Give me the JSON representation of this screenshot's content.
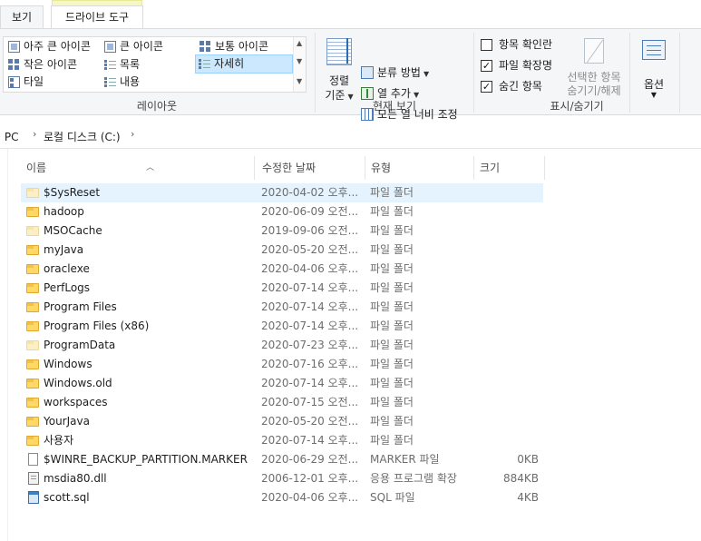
{
  "tabs": {
    "view": "보기",
    "drive_tools": "드라이브 도구"
  },
  "ribbon": {
    "layout": {
      "group_label": "레이아웃",
      "items": [
        "아주 큰 아이콘",
        "큰 아이콘",
        "보통 아이콘",
        "작은 아이콘",
        "목록",
        "자세히",
        "타일",
        "내용"
      ],
      "selected": "자세히"
    },
    "current_view": {
      "group_label": "현재 보기",
      "sort_label_1": "정렬",
      "sort_label_2": "기준",
      "group_by": "분류 방법",
      "add_column": "열 추가",
      "fit_columns": "모든 열 너비 조정"
    },
    "show_hide": {
      "group_label": "표시/숨기기",
      "item_checkboxes": {
        "label": "항목 확인란",
        "checked": false
      },
      "file_extensions": {
        "label": "파일 확장명",
        "checked": true
      },
      "hidden_items": {
        "label": "숨긴 항목",
        "checked": true
      },
      "hide_selected_1": "선택한 항목",
      "hide_selected_2": "숨기기/해제",
      "options": "옵션"
    }
  },
  "address": {
    "pc": "내 PC",
    "drive": "로컬 디스크 (C:)"
  },
  "columns": {
    "name": "이름",
    "date": "수정한 날짜",
    "type": "유형",
    "size": "크기"
  },
  "files": [
    {
      "name": "$SysReset",
      "date": "2020-04-02 오후...",
      "type": "파일 폴더",
      "size": "",
      "icon": "folder-faded-icon"
    },
    {
      "name": "hadoop",
      "date": "2020-06-09 오전...",
      "type": "파일 폴더",
      "size": "",
      "icon": "folder-icon"
    },
    {
      "name": "MSOCache",
      "date": "2019-09-06 오전...",
      "type": "파일 폴더",
      "size": "",
      "icon": "folder-faded-icon"
    },
    {
      "name": "myJava",
      "date": "2020-05-20 오전...",
      "type": "파일 폴더",
      "size": "",
      "icon": "folder-icon"
    },
    {
      "name": "oraclexe",
      "date": "2020-04-06 오후...",
      "type": "파일 폴더",
      "size": "",
      "icon": "folder-icon"
    },
    {
      "name": "PerfLogs",
      "date": "2020-07-14 오후...",
      "type": "파일 폴더",
      "size": "",
      "icon": "folder-icon"
    },
    {
      "name": "Program Files",
      "date": "2020-07-14 오후...",
      "type": "파일 폴더",
      "size": "",
      "icon": "folder-icon"
    },
    {
      "name": "Program Files (x86)",
      "date": "2020-07-14 오후...",
      "type": "파일 폴더",
      "size": "",
      "icon": "folder-icon"
    },
    {
      "name": "ProgramData",
      "date": "2020-07-23 오후...",
      "type": "파일 폴더",
      "size": "",
      "icon": "folder-faded-icon"
    },
    {
      "name": "Windows",
      "date": "2020-07-16 오후...",
      "type": "파일 폴더",
      "size": "",
      "icon": "folder-icon"
    },
    {
      "name": "Windows.old",
      "date": "2020-07-14 오후...",
      "type": "파일 폴더",
      "size": "",
      "icon": "folder-icon"
    },
    {
      "name": "workspaces",
      "date": "2020-07-15 오전...",
      "type": "파일 폴더",
      "size": "",
      "icon": "folder-icon"
    },
    {
      "name": "YourJava",
      "date": "2020-05-20 오전...",
      "type": "파일 폴더",
      "size": "",
      "icon": "folder-icon"
    },
    {
      "name": "사용자",
      "date": "2020-07-14 오후...",
      "type": "파일 폴더",
      "size": "",
      "icon": "folder-icon"
    },
    {
      "name": "$WINRE_BACKUP_PARTITION.MARKER",
      "date": "2020-06-29 오전...",
      "type": "MARKER 파일",
      "size": "0KB",
      "icon": "file-icon"
    },
    {
      "name": "msdia80.dll",
      "date": "2006-12-01 오후...",
      "type": "응용 프로그램 확장",
      "size": "884KB",
      "icon": "dll-file-icon"
    },
    {
      "name": "scott.sql",
      "date": "2020-04-06 오후...",
      "type": "SQL 파일",
      "size": "4KB",
      "icon": "sql-file-icon"
    }
  ],
  "selected_file": "$SysReset"
}
